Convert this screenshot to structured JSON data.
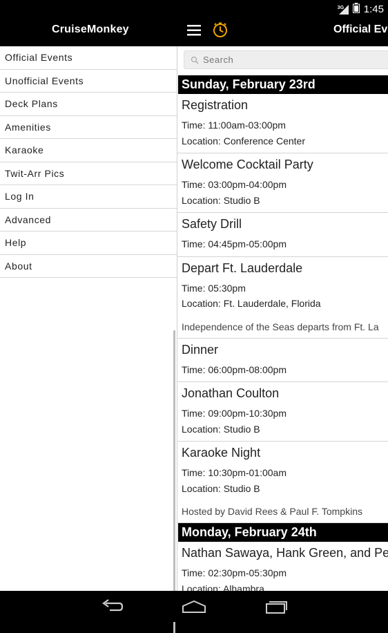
{
  "status": {
    "network": "3G",
    "time": "1:45"
  },
  "appbar": {
    "title": "CruiseMonkey",
    "page_title": "Official Eve"
  },
  "sidebar": {
    "items": [
      {
        "label": "Official Events"
      },
      {
        "label": "Unofficial Events"
      },
      {
        "label": "Deck Plans"
      },
      {
        "label": "Amenities"
      },
      {
        "label": "Karaoke"
      },
      {
        "label": "Twit-Arr Pics"
      },
      {
        "label": "Log In"
      },
      {
        "label": "Advanced"
      },
      {
        "label": "Help"
      },
      {
        "label": "About"
      }
    ]
  },
  "search": {
    "placeholder": "Search"
  },
  "days": [
    {
      "header": "Sunday, February 23rd",
      "events": [
        {
          "title": "Registration",
          "time": "Time: 11:00am-03:00pm",
          "location": "Location: Conference Center"
        },
        {
          "title": "Welcome Cocktail Party",
          "time": "Time: 03:00pm-04:00pm",
          "location": "Location: Studio B"
        },
        {
          "title": "Safety Drill",
          "time": "Time: 04:45pm-05:00pm"
        },
        {
          "title": "Depart Ft. Lauderdale",
          "time": "Time: 05:30pm",
          "location": "Location: Ft. Lauderdale, Florida",
          "description": "Independence of the Seas departs from Ft. La"
        },
        {
          "title": "Dinner",
          "time": "Time: 06:00pm-08:00pm"
        },
        {
          "title": "Jonathan Coulton",
          "time": "Time: 09:00pm-10:30pm",
          "location": "Location: Studio B"
        },
        {
          "title": "Karaoke Night",
          "time": "Time: 10:30pm-01:00am",
          "location": "Location: Studio B",
          "description": "Hosted by David Rees & Paul F. Tompkins"
        }
      ]
    },
    {
      "header": "Monday, February 24th",
      "events": [
        {
          "title": "Nathan Sawaya, Hank Green, and Pe",
          "time": "Time: 02:30pm-05:30pm",
          "location": "Location: Alhambra"
        }
      ]
    }
  ]
}
